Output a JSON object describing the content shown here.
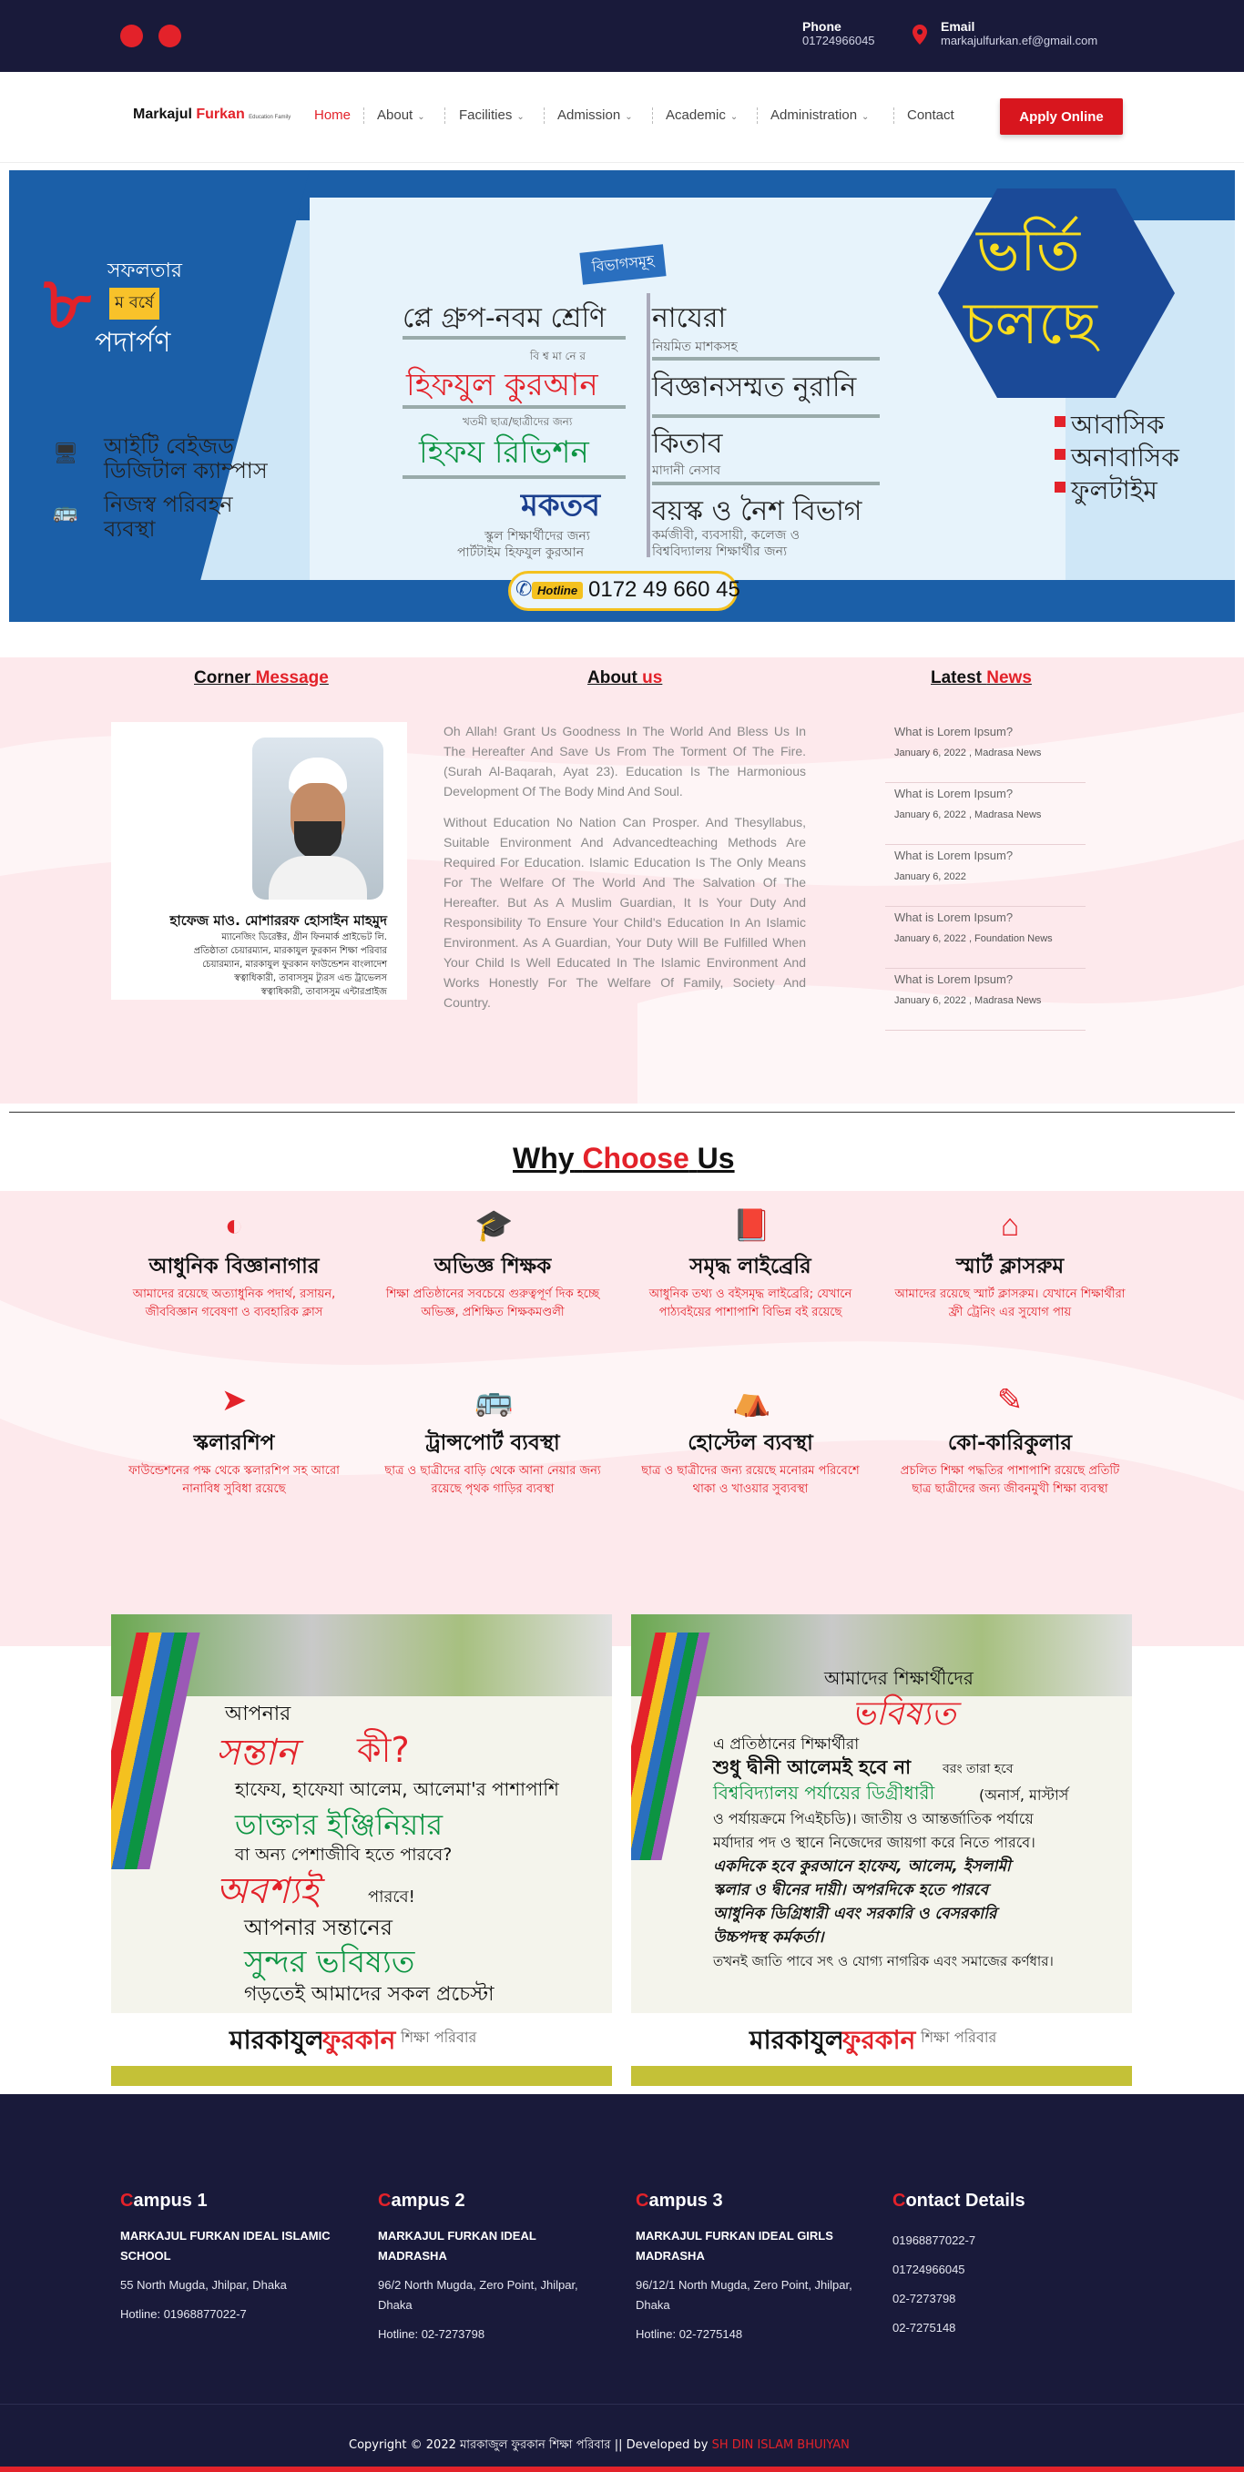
{
  "topbar": {
    "phone_label": "Phone",
    "phone_value": "01724966045",
    "email_label": "Email",
    "email_value": "markajulfurkan.ef@gmail.com"
  },
  "logo": {
    "part1": "Markajul",
    "part2": "Furkan",
    "tagline": "Education Family"
  },
  "nav": {
    "home": "Home",
    "about": "About",
    "facilities": "Facilities",
    "admission": "Admission",
    "academic": "Academic",
    "administration": "Administration",
    "contact": "Contact",
    "apply": "Apply Online"
  },
  "banner": {
    "years_a": "সফলতার",
    "years_num": "৮",
    "years_b": "ম বর্ষে",
    "years_c": "পদার্পণ",
    "it_campus": "আইটি বেইজড\nডিজিটাল ক্যাম্পাস",
    "transport": "নিজস্ব পরিবহন\nব্যবস্থা",
    "dept_tag": "বিভাগসমূহ",
    "play_group": "প্লে গ্রুপ-নবম শ্রেণি",
    "bishwaman": "বি শ্ব মা নে র",
    "hifzul": "হিফযুল কুরআন",
    "khatmi": "খতমী ছাত্র/ছাত্রীদের জন্য",
    "revision": "হিফয রিভিশন",
    "maktab": "মকতব",
    "school_students": "স্কুল শিক্ষার্থীদের জন্য",
    "parttime": "পার্টটাইম হিফযুল কুরআন",
    "nazera": "নাযেরা",
    "nazera_sub": "নিয়মিত মাশকসহ",
    "nurani": "বিজ্ঞানসম্মত নুরানি",
    "kitab": "কিতাব",
    "kitab_sub": "মাদানী নেসাব",
    "adult": "বয়স্ক ও নৈশ বিভাগ",
    "adult_sub": "কর্মজীবী, ব্যবসায়ী, কলেজ ও\nবিশ্ববিদ্যালয় শিক্ষার্থীর জন্য",
    "admission_a": "ভর্তি",
    "admission_b": "চলছে",
    "residential": "আবাসিক",
    "nonresidential": "অনাবাসিক",
    "fulltime": "ফুলটাইম",
    "hotline_label": "Hotline",
    "hotline_number": "0172 49 660 45"
  },
  "corner": {
    "title_a": "Corner",
    "title_b": "Message",
    "name": "হাফেজ মাও. মোশাররফ হোসাইন মাহমুদ",
    "roles": [
      "ম্যানেজিং ডিরেক্টর, গ্রীন ফিনমার্ক প্রাইভেট লি.",
      "প্রতিষ্ঠাতা চেয়ারম্যান, মারকাযুল ফুরকান শিক্ষা পরিবার",
      "চেয়ারম্যান, মারকাযুল ফুরকান ফাউন্ডেশন বাংলাদেশ",
      "স্বত্বাধিকারী, তাবাসসুম ট্যুরস এন্ড ট্রাভেলস",
      "স্বত্বাধিকারী, তাবাসসুম এন্টারপ্রাইজ"
    ]
  },
  "about": {
    "title_a": "About",
    "title_b": "us",
    "p1": "Oh Allah! Grant Us Goodness In The World And Bless Us In The Hereafter And Save Us From The Torment Of The Fire. (Surah Al-Baqarah, Ayat 23). Education Is The Harmonious Development Of The Body Mind And Soul.",
    "p2": "Without Education No Nation Can Prosper. And Thesyllabus, Suitable Environment And Advancedteaching Methods Are Required For Education. Islamic Education Is The Only Means For The Welfare Of The World And The Salvation Of The Hereafter. But As A Muslim Guardian, It Is Your Duty And Responsibility To Ensure Your Child's Education In An Islamic Environment. As A Guardian, Your Duty Will Be Fulfilled When Your Child Is Well Educated In The Islamic Environment And Works Honestly For The Welfare Of Family, Society And Country."
  },
  "news": {
    "title_a": "Latest",
    "title_b": "News",
    "items": [
      {
        "q": "What is Lorem Ipsum?",
        "meta": "January 6, 2022 , Madrasa News"
      },
      {
        "q": "What is Lorem Ipsum?",
        "meta": "January 6, 2022 , Madrasa News"
      },
      {
        "q": "What is Lorem Ipsum?",
        "meta": "January 6, 2022"
      },
      {
        "q": "What is Lorem Ipsum?",
        "meta": "January 6, 2022 , Foundation News"
      },
      {
        "q": "What is Lorem Ipsum?",
        "meta": "January 6, 2022 , Madrasa News"
      }
    ]
  },
  "why": {
    "title_a": "Why",
    "title_b": "Choose",
    "title_c": "Us",
    "features": [
      {
        "icon": "flask-icon",
        "title": "আধুনিক বিজ্ঞানাগার",
        "desc": "আমাদের রয়েছে অত্যাধুনিক পদার্থ, রসায়ন, জীববিজ্ঞান গবেষণা ও ব্যবহারিক ক্লাস"
      },
      {
        "icon": "graduation-cap-icon",
        "title": "অভিজ্ঞ শিক্ষক",
        "desc": "শিক্ষা প্রতিষ্ঠানের সবচেয়ে গুরুত্বপূর্ণ দিক হচ্ছে অভিজ্ঞ, প্রশিক্ষিত শিক্ষকমণ্ডলী"
      },
      {
        "icon": "book-icon",
        "title": "সমৃদ্ধ লাইব্রেরি",
        "desc": "আধুনিক তথ্য ও বইসমৃদ্ধ লাইব্রেরি; যেখানে পাঠ্যবইয়ের পাশাপাশি বিভিন্ন বই রয়েছে"
      },
      {
        "icon": "classroom-icon",
        "title": "স্মার্ট ক্লাসরুম",
        "desc": "আমাদের রয়েছে স্মার্ট ক্লাসরুম। যেখানে শিক্ষার্থীরা ফ্রী ট্রেনিং এর সুযোগ পায়"
      },
      {
        "icon": "scholarship-icon",
        "title": "স্কলারশিপ",
        "desc": "ফাউন্ডেশনের পক্ষ থেকে স্কলারশিপ সহ আরো নানাবিধ সুবিধা রয়েছে"
      },
      {
        "icon": "bus-icon",
        "title": "ট্রান্সপোর্ট ব্যবস্থা",
        "desc": "ছাত্র ও ছাত্রীদের বাড়ি থেকে আনা নেয়ার জন্য রয়েছে পৃথক গাড়ির ব্যবস্থা"
      },
      {
        "icon": "hostel-icon",
        "title": "হোস্টেল ব্যবস্থা",
        "desc": "ছাত্র ও ছাত্রীদের জন্য রয়েছে মনোরম পরিবেশে থাকা ও খাওয়ার সুব্যবস্থা"
      },
      {
        "icon": "co-curricular-icon",
        "title": "কো-কারিকুলার",
        "desc": "প্রচলিত শিক্ষা পদ্ধতির পাশাপাশি রয়েছে প্রতিটি ছাত্র ছাত্রীদের জন্য জীবনমুখী শিক্ষা ব্যবস্থা"
      }
    ]
  },
  "poster1": {
    "l1": "আপনার",
    "l2": "সন্তান",
    "l3": "কী?",
    "l4": "হাফেয, হাফেযা আলেম, আলেমা'র পাশাপাশি",
    "l5": "ডাক্তার ইঞ্জিনিয়ার",
    "l6": "বা অন্য পেশাজীবি হতে পারবে?",
    "l7": "অবশ্যই",
    "l8": "পারবে!",
    "l9": "আপনার সন্তানের",
    "l10": "সুন্দর ভবিষ্যত",
    "l11": "গড়তেই আমাদের সকল প্রচেস্টা",
    "brand_a": "মারকাযুল",
    "brand_b": "ফুরকান",
    "brand_c": "শিক্ষা পরিবার"
  },
  "poster2": {
    "l1": "আমাদের শিক্ষার্থীদের",
    "l2": "ভবিষ্যত",
    "l3": "এ প্রতিষ্ঠানের শিক্ষার্থীরা",
    "l4": "শুধু দ্বীনী আলেমই হবে না",
    "l4b": "বরং তারা হবে",
    "l5": "বিশ্ববিদ্যালয় পর্যায়ের ডিগ্রীধারী",
    "l5b": "(অনার্স, মাস্টার্স",
    "l6": "ও পর্যায়ক্রমে পিএইচডি)। জাতীয় ও আন্তর্জাতিক পর্যায়ে",
    "l7": "মর্যাদার পদ ও স্থানে নিজেদের জায়গা করে নিতে পারবে।",
    "l8": "একদিকে হবে কুরআনে হাফেয, আলেম, ইসলামী",
    "l9": "স্কলার ও দ্বীনের দায়ী। অপরদিকে হতে পারবে",
    "l10": "আধুনিক ডিগ্রিধারী এবং সরকারি ও বেসরকারি",
    "l11": "উচ্চপদস্থ কর্মকর্তা।",
    "l12": "তখনই জাতি পাবে সৎ ও যোগ্য নাগরিক এবং সমাজের কর্ণধার।",
    "brand_a": "মারকাযুল",
    "brand_b": "ফুরকান",
    "brand_c": "শিক্ষা পরিবার"
  },
  "footer": {
    "campus1": {
      "title_a": "C",
      "title_b": "ampus 1",
      "name": "MARKAJUL FURKAN IDEAL ISLAMIC SCHOOL",
      "addr": "55 North Mugda, Jhilpar, Dhaka",
      "hotline": "Hotline: 01968877022-7"
    },
    "campus2": {
      "title_a": "C",
      "title_b": "ampus 2",
      "name": "MARKAJUL FURKAN IDEAL MADRASHA",
      "addr": "96/2 North Mugda, Zero Point, Jhilpar, Dhaka",
      "hotline": "Hotline: 02-7273798"
    },
    "campus3": {
      "title_a": "C",
      "title_b": "ampus 3",
      "name": "MARKAJUL FURKAN IDEAL GIRLS MADRASHA",
      "addr": "96/12/1 North Mugda, Zero Point, Jhilpar, Dhaka",
      "hotline": "Hotline: 02-7275148"
    },
    "contact": {
      "title_a": "C",
      "title_b": "ontact Details",
      "lines": [
        "01968877022-7",
        "01724966045",
        "02-7273798",
        "02-7275148"
      ]
    },
    "copyright": "Copyright © 2022 মারকাজুল ফুরকান শিক্ষা পরিবার || Developed by",
    "developer": "SH DIN ISLAM BHUIYAN"
  },
  "colors": {
    "navy": "#191a3a",
    "red": "#e3222a",
    "pink": "#fde9ec",
    "banner_blue": "#1b5fa8"
  }
}
